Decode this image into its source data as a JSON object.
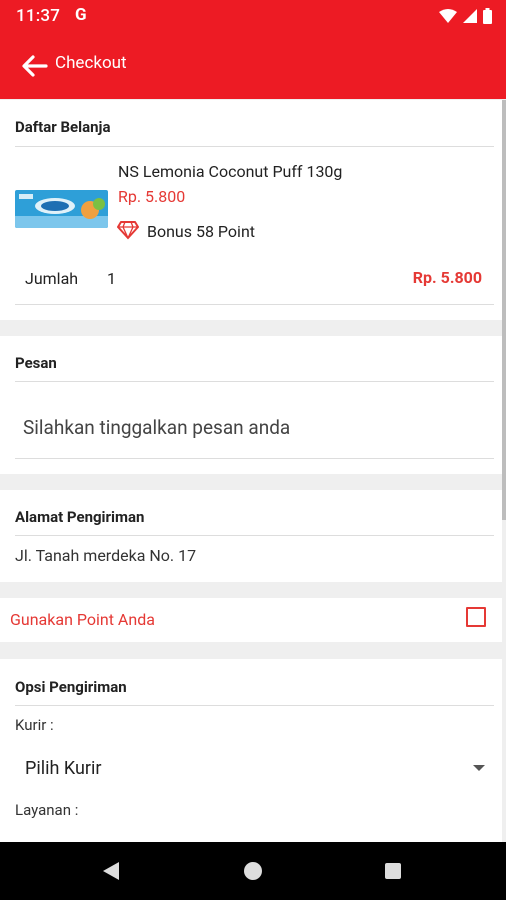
{
  "status_bar": {
    "time": "11:37",
    "g_label": "G"
  },
  "app_bar": {
    "title": "Checkout"
  },
  "cart": {
    "title": "Daftar Belanja",
    "product": {
      "name": "NS Lemonia Coconut Puff 130g",
      "price": "Rp. 5.800",
      "bonus": "Bonus 58 Point"
    },
    "quantity_label": "Jumlah",
    "quantity_value": "1",
    "total": "Rp. 5.800"
  },
  "message": {
    "title": "Pesan",
    "placeholder": "Silahkan tinggalkan pesan anda"
  },
  "address": {
    "title": "Alamat Pengiriman",
    "value": "Jl. Tanah merdeka No. 17"
  },
  "points": {
    "label": "Gunakan Point Anda"
  },
  "shipping": {
    "title": "Opsi Pengiriman",
    "courier_label": "Kurir :",
    "courier_value": "Pilih Kurir",
    "service_label": "Layanan :"
  },
  "colors": {
    "primary": "#ed1b24",
    "accent_text": "#e53935"
  }
}
